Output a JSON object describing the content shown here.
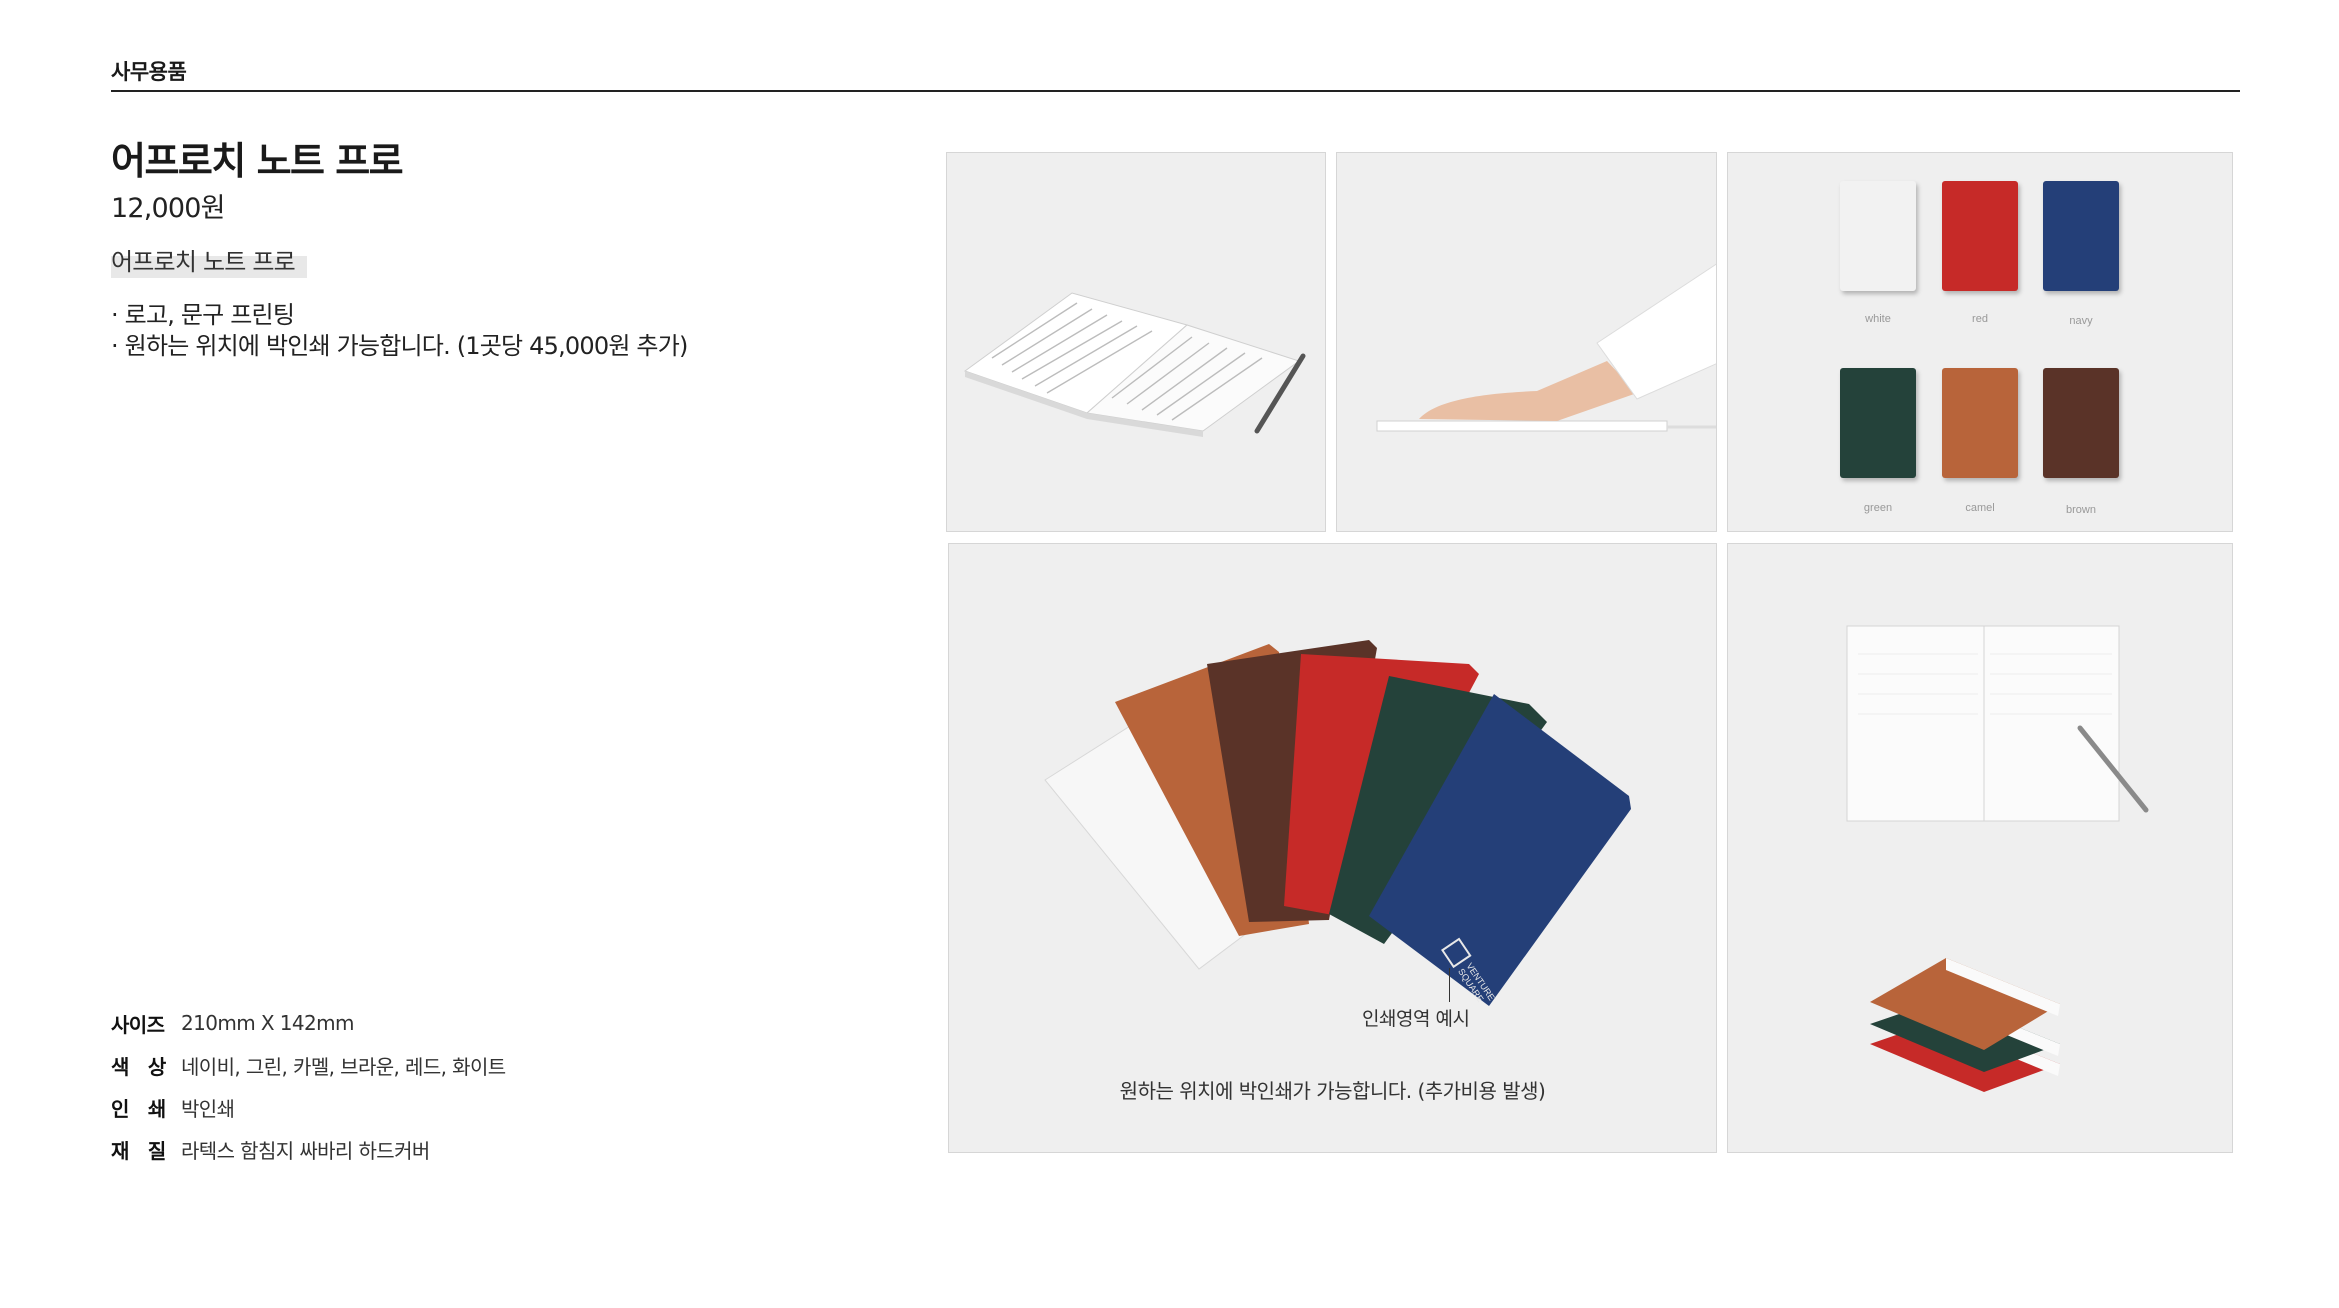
{
  "header": {
    "category": "사무용품"
  },
  "product": {
    "title": "어프로치 노트 프로",
    "price": "12,000원",
    "subname": "어프로치 노트 프로",
    "features": [
      "· 로고, 문구 프린팅",
      "· 원하는 위치에  박인쇄 가능합니다. (1곳당 45,000원 추가)"
    ]
  },
  "specs": [
    {
      "label": "사이즈",
      "value": "210mm X 142mm"
    },
    {
      "label": "색   상",
      "value": "네이비, 그린, 카멜, 브라운, 레드, 화이트"
    },
    {
      "label": "인   쇄",
      "value": "박인쇄"
    },
    {
      "label": "재   질",
      "value": "라텍스 함침지 싸바리 하드커버"
    }
  ],
  "color_swatches": [
    {
      "name": "white",
      "color": "#f2f2f2"
    },
    {
      "name": "red",
      "color": "#c62a28"
    },
    {
      "name": "navy",
      "color": "#243f78"
    },
    {
      "name": "green",
      "color": "#24423a"
    },
    {
      "name": "camel",
      "color": "#b8643a"
    },
    {
      "name": "brown",
      "color": "#5a3328"
    }
  ],
  "gallery": {
    "print_area_label": "인쇄영역 예시",
    "print_note": "원하는 위치에 박인쇄가 가능합니다. (추가비용 발생)",
    "logo_text": "VENTURE SQUARE"
  }
}
